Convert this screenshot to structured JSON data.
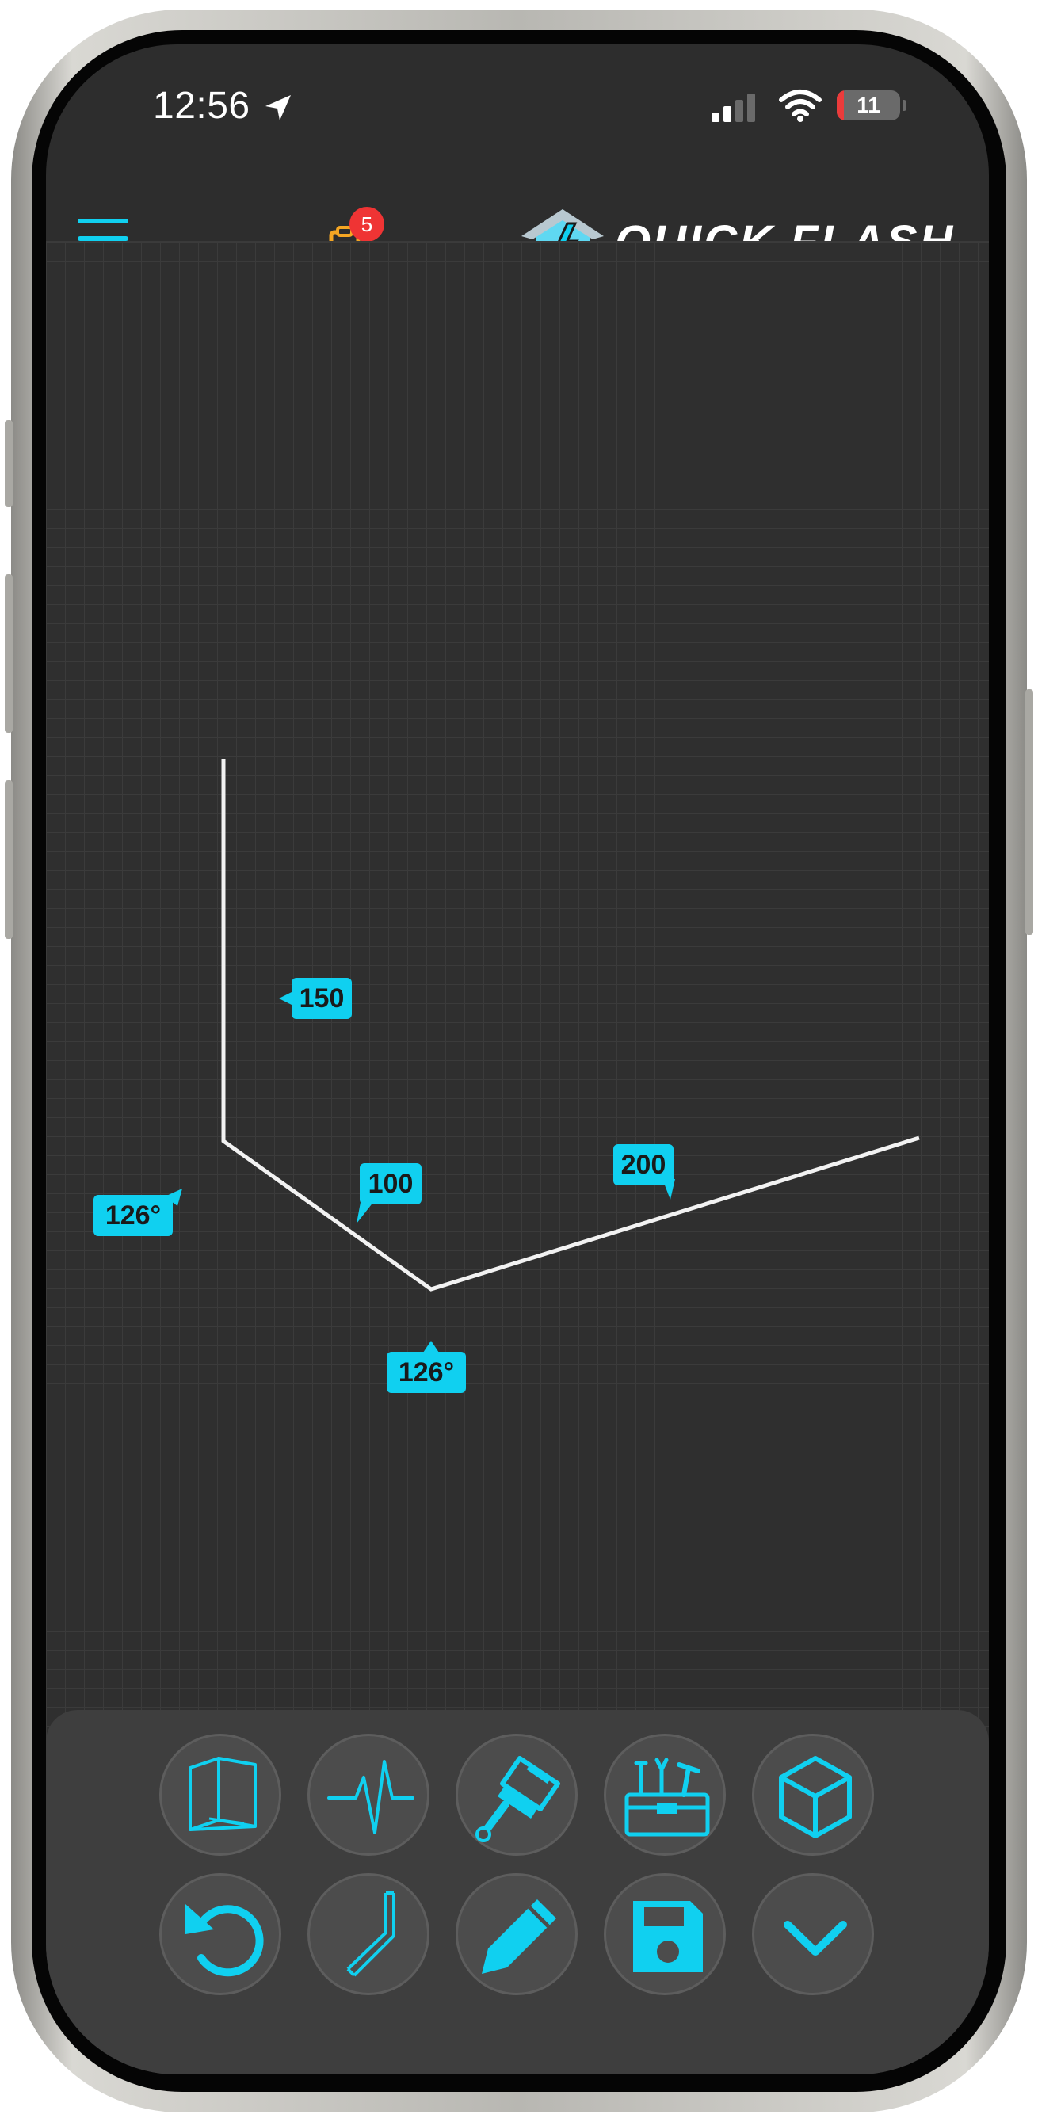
{
  "status_bar": {
    "time": "12:56",
    "battery_percent": "11",
    "battery_level": 0.11,
    "icons": [
      "location-arrow-icon",
      "cellular-signal-icon",
      "wifi-icon",
      "battery-icon"
    ]
  },
  "header": {
    "menu_icon": "hamburger-menu-icon",
    "tasks_icon": "clipboard-check-icon",
    "tasks_badge": "5",
    "logo_text": "QUICK FLASH",
    "accent_color": "#10d0f0",
    "badge_color": "#ef3434",
    "tasks_icon_color": "#f5a623"
  },
  "drawing": {
    "segment_lengths": [
      "150",
      "100",
      "200"
    ],
    "angles": [
      "126°",
      "126°"
    ],
    "line_color": "#ffffff",
    "tag_color": "#10d0f0"
  },
  "toolbar": {
    "row1": [
      {
        "name": "fold-icon"
      },
      {
        "name": "pulse-wave-icon"
      },
      {
        "name": "paint-brush-icon"
      },
      {
        "name": "toolbox-icon"
      },
      {
        "name": "cube-3d-icon"
      }
    ],
    "row2": [
      {
        "name": "undo-icon"
      },
      {
        "name": "bend-profile-icon"
      },
      {
        "name": "pencil-icon"
      },
      {
        "name": "save-floppy-icon"
      },
      {
        "name": "chevron-down-icon"
      }
    ]
  }
}
